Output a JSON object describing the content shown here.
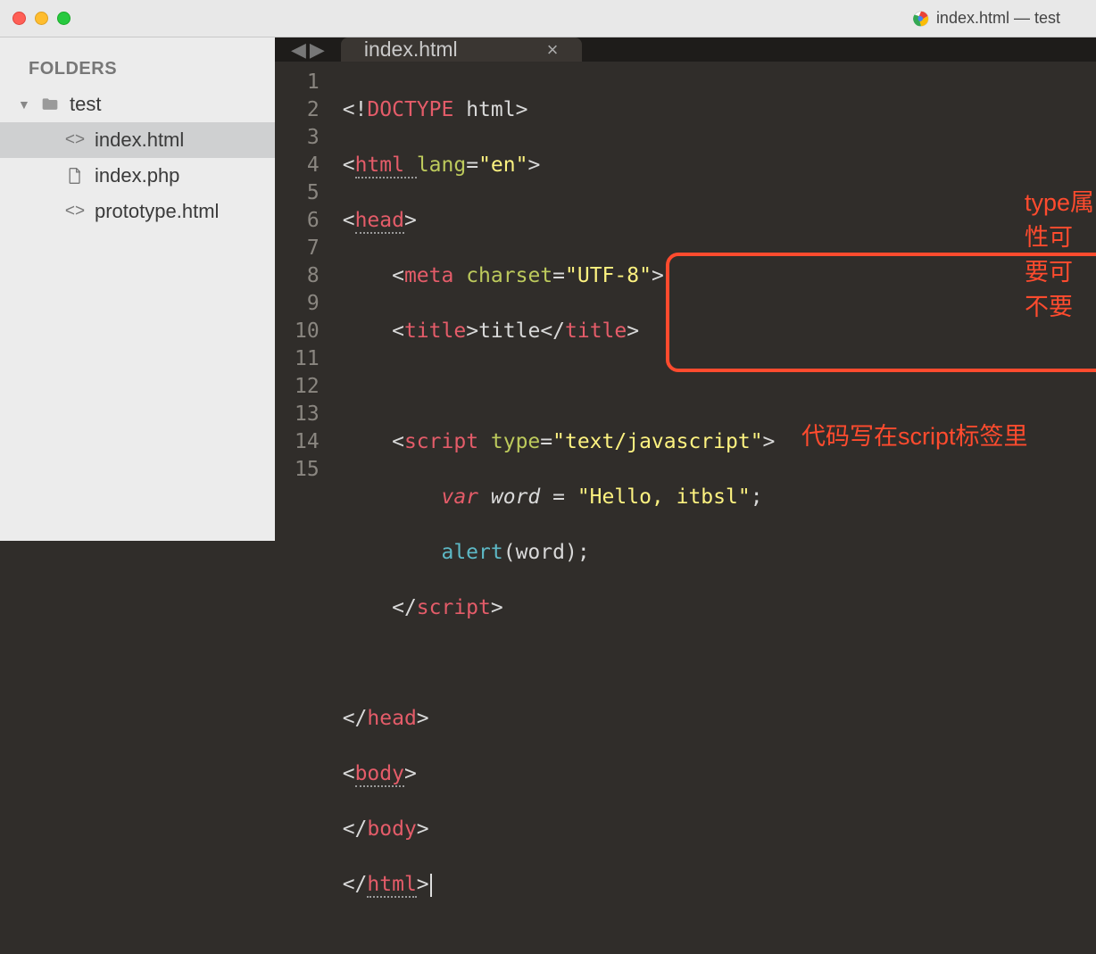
{
  "titlebar": {
    "title": "index.html — test"
  },
  "sidebar": {
    "header": "FOLDERS",
    "folder": "test",
    "files": [
      "index.html",
      "index.php",
      "prototype.html"
    ]
  },
  "tab": {
    "label": "index.html",
    "close": "×"
  },
  "gutter": [
    "1",
    "2",
    "3",
    "4",
    "5",
    "6",
    "7",
    "8",
    "9",
    "10",
    "11",
    "12",
    "13",
    "14",
    "15"
  ],
  "code": {
    "l1": {
      "a": "<!",
      "b": "DOCTYPE ",
      "c": "html",
      "d": ">"
    },
    "l2": {
      "a": "<",
      "b": "html ",
      "c": "lang",
      "d": "=",
      "e": "\"en\"",
      "f": ">"
    },
    "l3": {
      "a": "<",
      "b": "head",
      "c": ">"
    },
    "l4": {
      "a": "<",
      "b": "meta ",
      "c": "charset",
      "d": "=",
      "e": "\"UTF-8\"",
      "f": ">"
    },
    "l5": {
      "a": "<",
      "b": "title",
      "c": ">",
      "d": "title",
      "e": "</",
      "f": "title",
      "g": ">"
    },
    "l7": {
      "a": "<",
      "b": "script ",
      "c": "type",
      "d": "=",
      "e": "\"text/javascript\"",
      "f": ">"
    },
    "l8": {
      "a": "var",
      "b": " word ",
      "c": "= ",
      "d": "\"Hello, itbsl\"",
      "e": ";"
    },
    "l9": {
      "a": "alert",
      "b": "(word);"
    },
    "l10": {
      "a": "</",
      "b": "script",
      "c": ">"
    },
    "l12": {
      "a": "</",
      "b": "head",
      "c": ">"
    },
    "l13": {
      "a": "<",
      "b": "body",
      "c": ">"
    },
    "l14": {
      "a": "</",
      "b": "body",
      "c": ">"
    },
    "l15": {
      "a": "</",
      "b": "html",
      "c": ">"
    }
  },
  "annotations": {
    "a1": "type属性可要可不要",
    "a2": "代码写在script标签里"
  }
}
